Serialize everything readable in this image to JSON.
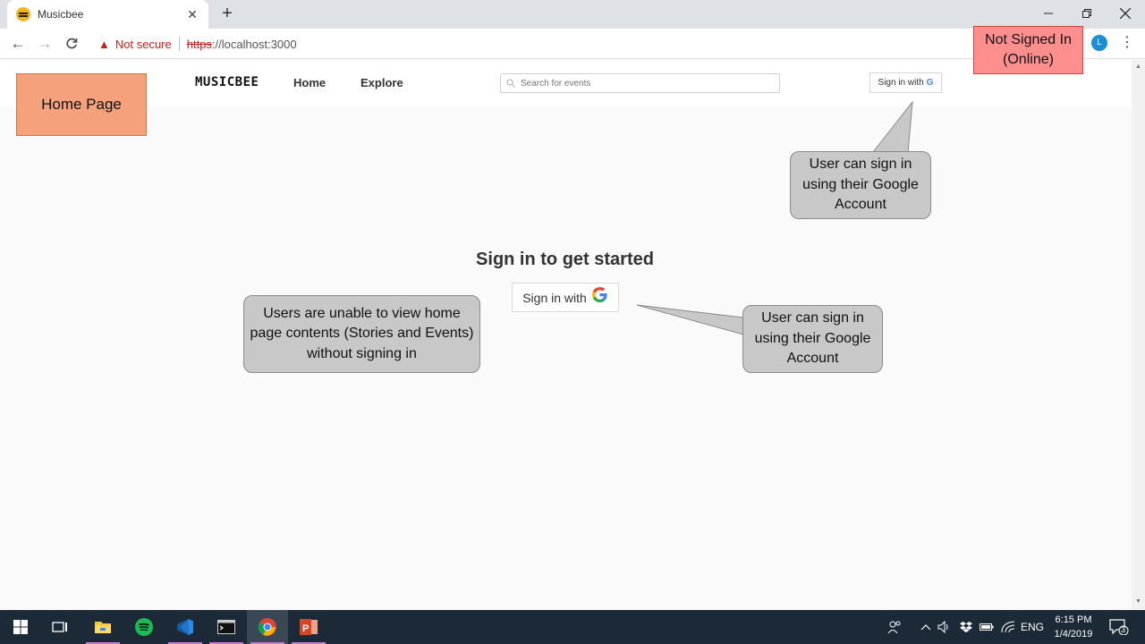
{
  "browser": {
    "tab_title": "Musicbee",
    "url_security": "Not secure",
    "url_protocol": "https",
    "url_rest": "://localhost:3000",
    "profile_initial": "L"
  },
  "site": {
    "logo": "MUSICBEE",
    "nav": [
      "Home",
      "Explore"
    ],
    "search_placeholder": "Search for events",
    "signin_small": "Sign in with",
    "google_letter": "G",
    "signin_title": "Sign in to get started",
    "signin_big": "Sign in with"
  },
  "annotations": {
    "page_label": "Home Page",
    "status_line1": "Not Signed In",
    "status_line2": "(Online)",
    "callout_top": "User can sign in using their Google Account",
    "callout_mid": "User can sign in using their Google Account",
    "callout_left": "Users are unable to view home page contents (Stories and Events) without signing in"
  },
  "taskbar": {
    "language": "ENG",
    "time": "6:15 PM",
    "date": "1/4/2019",
    "notification_count": "3"
  },
  "colors": {
    "page_label_bg": "#f5a27c",
    "status_bg": "#ff8f8f",
    "callout_bg": "#c8c8c8",
    "warning_red": "#c5221f",
    "taskbar_bg": "#1c2a38"
  }
}
